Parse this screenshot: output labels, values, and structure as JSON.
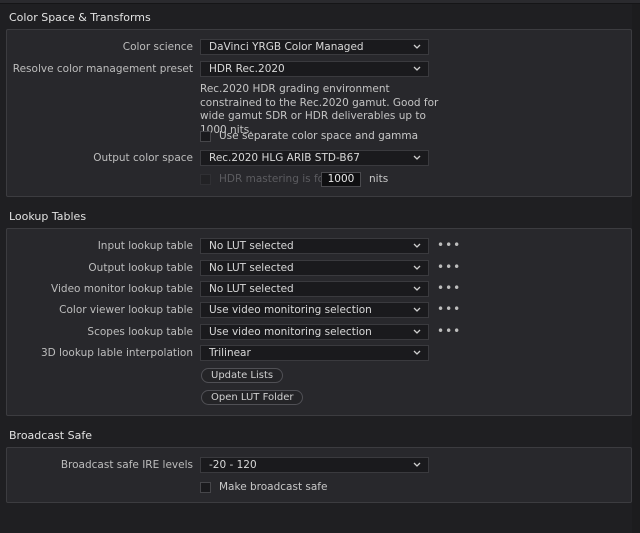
{
  "colorSpace": {
    "title": "Color Space & Transforms",
    "colorScience": {
      "label": "Color science",
      "value": "DaVinci YRGB Color Managed"
    },
    "preset": {
      "label": "Resolve color management preset",
      "value": "HDR Rec.2020"
    },
    "presetDescription": "Rec.2020 HDR grading environment constrained to the Rec.2020 gamut. Good for wide gamut SDR or HDR deliverables up to 1000 nits.",
    "separateGamma": {
      "label": "Use separate color space and gamma",
      "checked": false
    },
    "outputColorSpace": {
      "label": "Output color space",
      "value": "Rec.2020 HLG ARIB STD-B67"
    },
    "hdrMastering": {
      "label": "HDR mastering is for",
      "value": "1000",
      "unit": "nits",
      "enabled": false
    }
  },
  "lookupTables": {
    "title": "Lookup Tables",
    "rows": [
      {
        "label": "Input lookup table",
        "value": "No LUT selected"
      },
      {
        "label": "Output lookup table",
        "value": "No LUT selected"
      },
      {
        "label": "Video monitor lookup table",
        "value": "No LUT selected"
      },
      {
        "label": "Color viewer lookup table",
        "value": "Use video monitoring selection"
      },
      {
        "label": "Scopes lookup table",
        "value": "Use video monitoring selection"
      }
    ],
    "interpolation": {
      "label": "3D lookup lable interpolation",
      "value": "Trilinear"
    },
    "moreGlyph": "•••",
    "updateLists": "Update Lists",
    "openFolder": "Open LUT Folder"
  },
  "broadcastSafe": {
    "title": "Broadcast Safe",
    "ireLevels": {
      "label": "Broadcast safe IRE levels",
      "value": "-20 - 120"
    },
    "makeSafe": {
      "label": "Make broadcast safe",
      "checked": false
    }
  },
  "icons": {
    "dropdown": "chevron-down-icon",
    "more": "more-dots-icon"
  },
  "colors": {
    "background": "#1f1f22",
    "panel": "#28282c",
    "field": "#1a1a1d"
  }
}
